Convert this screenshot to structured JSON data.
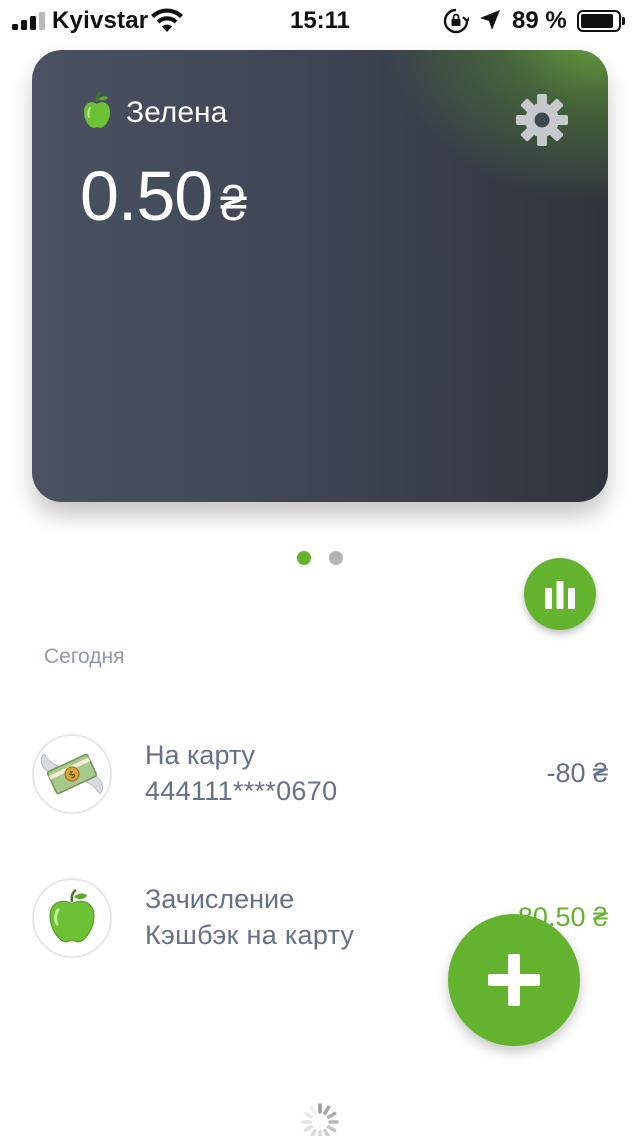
{
  "status_bar": {
    "carrier": "Kyivstar",
    "time": "15:11",
    "battery_percent": "89 %",
    "battery_level": 0.89,
    "signal_bars": 4,
    "signal_filled": 3
  },
  "card": {
    "name": "Зелена",
    "balance": "0.50",
    "currency": "₴",
    "icon": "green-apple-icon",
    "accent_color": "#63b32e"
  },
  "pager": {
    "pages": 2,
    "active": 1
  },
  "section": {
    "date_label": "Сегодня"
  },
  "transactions": [
    {
      "title": "На карту",
      "subtitle": "444111****0670",
      "amount": "-80 ₴",
      "icon": "money-with-wings-icon",
      "type": "debit"
    },
    {
      "title": "Зачисление",
      "subtitle": "Кэшбэк на карту",
      "amount": "80.50 ₴",
      "icon": "green-apple-icon",
      "type": "credit"
    }
  ],
  "colors": {
    "accent": "#63b32e",
    "text_secondary": "#65708a",
    "date_label": "#8f9aae"
  }
}
